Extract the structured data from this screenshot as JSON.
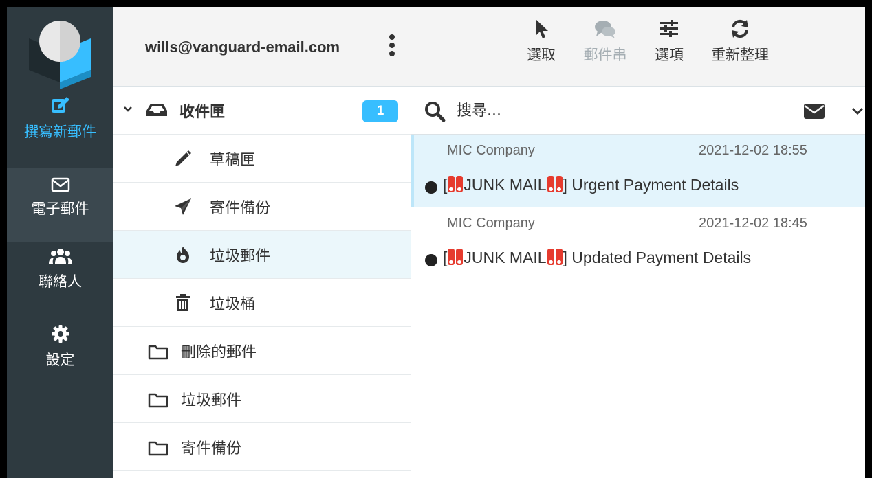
{
  "colors": {
    "rail_bg": "#2e3a40",
    "accent": "#37beff",
    "selected_bg": "#ebf7fb"
  },
  "rail": {
    "logo_icon": "roundcube-logo",
    "items": [
      {
        "label": "撰寫新郵件",
        "icon": "compose-icon",
        "active": false
      },
      {
        "label": "電子郵件",
        "icon": "envelope-icon",
        "active": true
      },
      {
        "label": "聯絡人",
        "icon": "users-icon",
        "active": false
      },
      {
        "label": "設定",
        "icon": "gear-icon",
        "active": false
      }
    ]
  },
  "account": {
    "email": "wills@vanguard-email.com"
  },
  "folders": [
    {
      "label": "收件匣",
      "icon": "inbox-icon",
      "unread": "1",
      "expanded": true
    },
    {
      "label": "草稿匣",
      "icon": "pencil-icon"
    },
    {
      "label": "寄件備份",
      "icon": "paper-plane-icon"
    },
    {
      "label": "垃圾郵件",
      "icon": "fire-icon",
      "selected": true
    },
    {
      "label": "垃圾桶",
      "icon": "trash-icon"
    },
    {
      "label": "刪除的郵件",
      "icon": "folder-icon"
    },
    {
      "label": "垃圾郵件",
      "icon": "folder-icon"
    },
    {
      "label": "寄件備份",
      "icon": "folder-icon"
    }
  ],
  "toolbar": {
    "select": "選取",
    "threads": "郵件串",
    "options": "選項",
    "refresh": "重新整理"
  },
  "search": {
    "placeholder": "搜尋..."
  },
  "messages": [
    {
      "from": "MIC Company",
      "date": "2021-12-02 18:55",
      "subject_prefix": "[",
      "subject_tag": "JUNK MAIL",
      "subject_close": "]",
      "subject_text": " Urgent Payment Details",
      "unread": true,
      "active": true
    },
    {
      "from": "MIC Company",
      "date": "2021-12-02 18:45",
      "subject_prefix": "[",
      "subject_tag": "JUNK MAIL",
      "subject_close": "]",
      "subject_text": " Updated Payment Details",
      "unread": true,
      "active": false
    }
  ]
}
